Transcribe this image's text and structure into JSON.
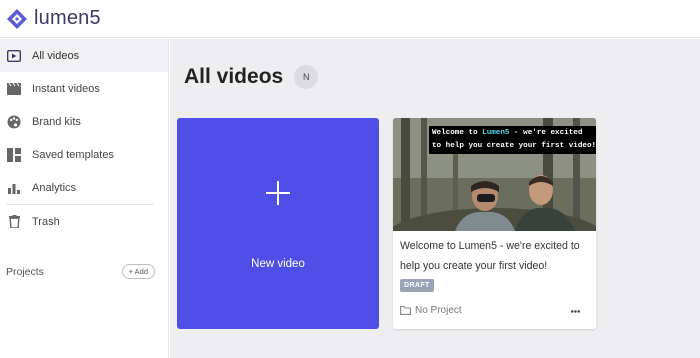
{
  "brand": {
    "name": "lumen5",
    "color": "#5b5bd6"
  },
  "sidebar": {
    "items": [
      {
        "label": "All videos",
        "icon": "play-window-icon",
        "active": true
      },
      {
        "label": "Instant videos",
        "icon": "clapperboard-icon",
        "active": false
      },
      {
        "label": "Brand kits",
        "icon": "palette-icon",
        "active": false
      },
      {
        "label": "Saved templates",
        "icon": "templates-icon",
        "active": false
      },
      {
        "label": "Analytics",
        "icon": "bar-chart-icon",
        "active": false
      },
      {
        "label": "Trash",
        "icon": "trash-icon",
        "active": false
      }
    ],
    "projects_label": "Projects",
    "add_label": "+ Add"
  },
  "main": {
    "title": "All videos",
    "avatar_initial": "N",
    "new_video_label": "New video",
    "accent": "#4f4fe8"
  },
  "video_card": {
    "caption_prefix": "Welcome to ",
    "caption_brand": "Lumen5",
    "caption_rest": " - we're excited",
    "caption_line2": "to help you create your first video!",
    "caption_brand_color": "#5ad6e6",
    "description": "Welcome to Lumen5 - we're excited to help you create your first video!",
    "status": "DRAFT",
    "project": "No Project",
    "more_icon": "ellipsis-icon"
  }
}
